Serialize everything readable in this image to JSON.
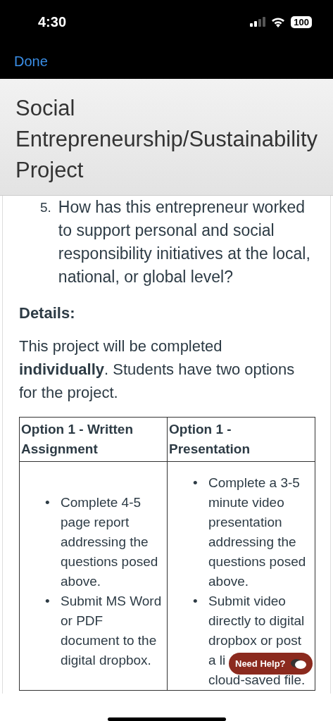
{
  "status_bar": {
    "time": "4:30",
    "battery": "100"
  },
  "nav": {
    "done": "Done"
  },
  "header": {
    "title": "Social Entrepreneurship/Sustainability Project"
  },
  "content": {
    "list_item": {
      "number": "5.",
      "text": "How has this entrepreneur worked to support personal and social responsibility initiatives at the local, national, or global level?"
    },
    "details_heading": "Details:",
    "paragraph": "This project will be completed **individually**. Students have two options for the project.",
    "table": {
      "columns": [
        "Option 1 - Written Assignment",
        "Option 1 - Presentation"
      ],
      "cells": [
        {
          "bullets": [
            {
              "marker": "•",
              "lines": [
                "Complete 4-5",
                "page report",
                "addressing the",
                "questions posed",
                "above."
              ]
            },
            {
              "marker": "•",
              "lines": [
                "Submit MS Word",
                "or PDF",
                "document to the",
                "digital dropbox."
              ]
            }
          ]
        },
        {
          "bullets": [
            {
              "marker": "•",
              "lines": [
                "Complete a 3-5",
                "minute video",
                "presentation",
                "addressing the",
                "questions posed",
                "above."
              ]
            },
            {
              "marker": "•",
              "lines": [
                "Submit video",
                "directly to digital",
                "dropbox or post",
                "a li",
                "cloud-saved file."
              ]
            }
          ]
        }
      ]
    }
  },
  "help_button": {
    "label": "Need Help?"
  }
}
